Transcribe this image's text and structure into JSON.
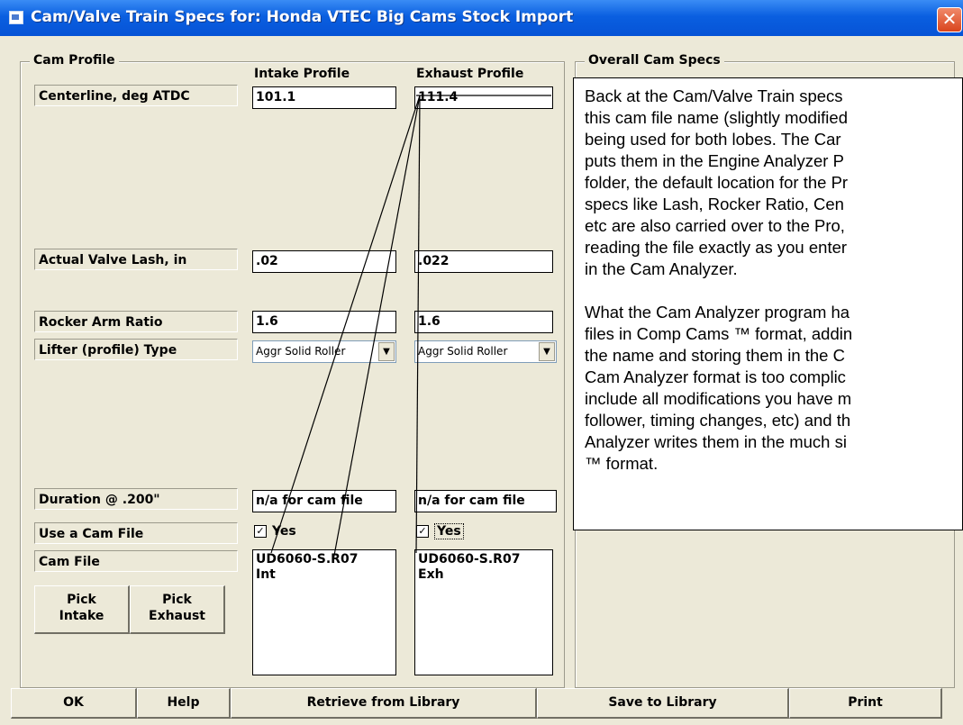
{
  "window": {
    "title": "Cam/Valve Train Specs for: Honda VTEC Big Cams Stock Import",
    "close_glyph": "✕"
  },
  "cam_profile": {
    "legend": "Cam Profile",
    "intake_header": "Intake Profile",
    "exhaust_header": "Exhaust Profile",
    "rows": {
      "centerline": {
        "label": "Centerline, deg ATDC",
        "intake": "101.1",
        "exhaust": "111.4"
      },
      "lash": {
        "label": "Actual Valve Lash, in",
        "intake": ".02",
        "exhaust": ".022"
      },
      "rocker": {
        "label": "Rocker Arm Ratio",
        "intake": "1.6",
        "exhaust": "1.6"
      },
      "lifter": {
        "label": "Lifter (profile) Type",
        "intake": "Aggr Solid Roller",
        "exhaust": "Aggr Solid Roller"
      },
      "duration": {
        "label": "Duration @ .200\"",
        "intake": "n/a for cam file",
        "exhaust": "n/a for cam file"
      },
      "use_cam_file": {
        "label": "Use a Cam File",
        "intake": "Yes",
        "exhaust": "Yes",
        "intake_checked": true,
        "exhaust_checked": true
      },
      "cam_file": {
        "label": "Cam File",
        "intake_line1": "UD6060-S.R07",
        "intake_line2": "Int",
        "exhaust_line1": "UD6060-S.R07",
        "exhaust_line2": "Exh"
      }
    },
    "pick_intake": {
      "line1": "Pick",
      "line2": "Intake"
    },
    "pick_exhaust": {
      "line1": "Pick",
      "line2": "Exhaust"
    }
  },
  "overall": {
    "legend": "Overall Cam Specs"
  },
  "note": {
    "paragraph1": [
      "Back at the Cam/Valve Train specs",
      "this cam file name (slightly modified",
      "being used for both lobes.  The Car",
      "puts them in the Engine Analyzer P",
      "folder, the default location for the Pr",
      "specs like Lash, Rocker Ratio, Cen",
      "etc are also carried over to the Pro,",
      "reading the file exactly as you enter",
      "in the Cam Analyzer."
    ],
    "paragraph2": [
      "What the Cam Analyzer program ha",
      "files in Comp Cams ™ format, addin",
      "the name and storing them in the C",
      "Cam Analyzer format is too complic",
      "include all modifications you have m",
      "follower, timing changes, etc) and th",
      "Analyzer writes them in the much si",
      "™ format."
    ]
  },
  "buttons": {
    "ok": "OK",
    "help": "Help",
    "retrieve": "Retrieve from Library",
    "save": "Save to Library",
    "print": "Print"
  },
  "colors": {
    "title_bar": "#0a5fe0",
    "dialog_bg": "#ece9d8",
    "close_button": "#d9441c"
  }
}
